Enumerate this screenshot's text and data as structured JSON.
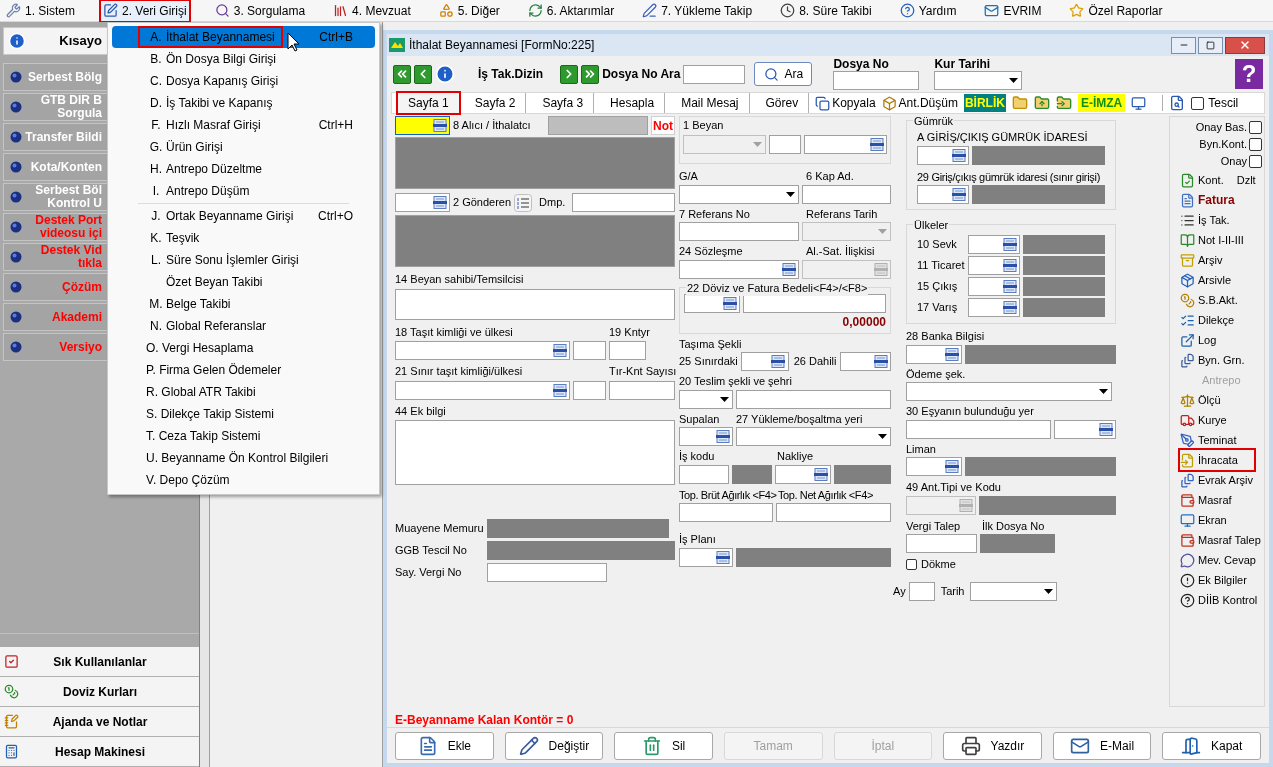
{
  "menubar": [
    {
      "label": "1. Sistem",
      "selected": false
    },
    {
      "label": "2. Veri Girişi",
      "selected": true
    },
    {
      "label": "3. Sorgulama",
      "selected": false
    },
    {
      "label": "4. Mevzuat",
      "selected": false
    },
    {
      "label": "5. Diğer",
      "selected": false
    },
    {
      "label": "6. Aktarımlar",
      "selected": false
    },
    {
      "label": "7. Yükleme Takip",
      "selected": false
    },
    {
      "label": "8. Süre Takibi",
      "selected": false
    },
    {
      "label": "Yardım",
      "selected": false
    },
    {
      "label": "EVRIM",
      "selected": false
    },
    {
      "label": "Özel Raporlar",
      "selected": false
    }
  ],
  "menu": {
    "groups": [
      [
        {
          "kind": "entry",
          "key": "A.",
          "label": "İthalat Beyannamesi",
          "shortcut": "Ctrl+B",
          "selected": true
        },
        {
          "kind": "entry",
          "key": "B.",
          "label": "Ön Dosya Bilgi Girişi",
          "selected": false
        },
        {
          "kind": "entry",
          "key": "C.",
          "label": "Dosya Kapanış Girişi",
          "selected": false
        },
        {
          "kind": "entry",
          "key": "D.",
          "label": "İş Takibi ve Kapanış",
          "selected": false
        },
        {
          "kind": "entry",
          "key": "F.",
          "label": "Hızlı Masraf Girişi",
          "shortcut": "Ctrl+H",
          "selected": false
        },
        {
          "kind": "entry",
          "key": "G.",
          "label": "Ürün Girişi",
          "selected": false
        },
        {
          "kind": "entry",
          "key": "H.",
          "label": "Antrepo Düzeltme",
          "selected": false
        },
        {
          "kind": "entry",
          "key": "I.",
          "label": "Antrepo Düşüm",
          "selected": false
        }
      ],
      [
        {
          "kind": "entry",
          "key": "J.",
          "label": "Ortak Beyanname Girişi",
          "shortcut": "Ctrl+O",
          "selected": false
        },
        {
          "kind": "entry",
          "key": "K.",
          "label": "Teşvik",
          "selected": false
        },
        {
          "kind": "entry",
          "key": "L.",
          "label": "Süre Sonu İşlemler Girişi",
          "selected": false
        },
        {
          "kind": "sub",
          "label": "Özet Beyan Takibi",
          "selected": false
        },
        {
          "kind": "entry",
          "key": "M.",
          "label": "Belge Takibi",
          "selected": false
        },
        {
          "kind": "entry",
          "key": "N.",
          "label": "Global Referanslar",
          "selected": false
        },
        {
          "kind": "plain",
          "label": "O. Vergi Hesaplama",
          "selected": false
        },
        {
          "kind": "plain",
          "label": "P. Firma Gelen Ödemeler",
          "selected": false
        },
        {
          "kind": "plain",
          "label": "R. Global ATR Takibi",
          "selected": false
        },
        {
          "kind": "plain",
          "label": "S. Dilekçe Takip Sistemi",
          "selected": false
        },
        {
          "kind": "plain",
          "label": "T. Ceza Takip Sistemi",
          "selected": false
        },
        {
          "kind": "plain",
          "label": "U. Beyanname Ön Kontrol Bilgileri",
          "selected": false
        },
        {
          "kind": "plain",
          "label": "V. Depo Çözüm",
          "selected": false
        }
      ]
    ]
  },
  "sidebar": {
    "header": "Kısayo",
    "items": [
      {
        "text": "Serbest Bölg",
        "kind": "normal"
      },
      {
        "text": "GTB DIR B\nSorgula",
        "kind": "normal"
      },
      {
        "text": "Transfer Bildi",
        "kind": "normal"
      },
      {
        "text": "Kota/Konten",
        "kind": "normal"
      },
      {
        "text": "Serbest Böl\nKontrol U",
        "kind": "normal"
      },
      {
        "text": "Destek Port\nvideosu içi",
        "kind": "support"
      },
      {
        "text": "Destek Vid\ntıkla",
        "kind": "support"
      },
      {
        "text": "Çözüm",
        "kind": "support"
      },
      {
        "text": "Akademi",
        "kind": "support"
      },
      {
        "text": "Versiyo",
        "kind": "support"
      }
    ],
    "bottom": [
      {
        "label": "Sık Kullanılanlar"
      },
      {
        "label": "Doviz Kurları"
      },
      {
        "label": "Ajanda ve Notlar"
      },
      {
        "label": "Hesap Makinesi"
      }
    ]
  },
  "window": {
    "title": "İthalat Beyannamesi [FormNo:225]"
  },
  "toolbar": {
    "dizin": "İş Tak.Dizin",
    "dosya_ara": "Dosya No Ara",
    "ara": "Ara",
    "dosya_no": "Dosya No",
    "kur_tarihi": "Kur Tarihi",
    "help": "?"
  },
  "tabs": [
    {
      "label": "Sayfa 1",
      "selected": true
    },
    {
      "label": "Sayfa 2",
      "selected": false
    },
    {
      "label": "Sayfa 3",
      "selected": false
    },
    {
      "label": "Hesapla",
      "selected": false
    },
    {
      "label": "Mail Mesaj",
      "selected": false
    },
    {
      "label": "Görev",
      "selected": false
    }
  ],
  "tab_tools": [
    {
      "label": "Kopyala"
    },
    {
      "label": "Ant.Düşüm"
    }
  ],
  "badges": [
    {
      "label": "BİRLİK",
      "color": "#008080"
    },
    {
      "label": "E-İMZA",
      "color": "#ffff00"
    }
  ],
  "tescil": {
    "label": "Tescil",
    "checked": false
  },
  "form": {
    "alici": "8 Alıcı / İthalatcı",
    "alici_focused": true,
    "not": "Not",
    "gonderen": "2 Gönderen",
    "dmp": "Dmp.",
    "beyan_sahibi": "14 Beyan sahibi/Temsilcisi",
    "tasit": "18 Taşıt kimliği ve ülkesi",
    "kntyr": "19 Kntyr",
    "sinir_tasit": "21 Sınır taşıt kimliği/ülkesi",
    "tir_knt": "Tır-Knt Sayısı",
    "ek_bilgi": "44 Ek bilgi",
    "muayene": "Muayene Memuru",
    "ggb": "GGB Tescil No",
    "say_vergi": "Say. Vergi No",
    "beyan": "1 Beyan",
    "ga": "G/A",
    "kap": "6 Kap Ad.",
    "referans_no": "7 Referans No",
    "referans_tarih": "Referans Tarih",
    "sozlesme": "24 Sözleşme",
    "al_sat": "Al.-Sat. İlişkisi",
    "doviz": "22 Döviz ve Fatura Bedeli<F4>/<F8>",
    "doviz_value": "0,00000",
    "tasima": "Taşıma Şekli",
    "sinirdaki": "25 Sınırdaki",
    "dahili": "26 Dahili",
    "teslim": "20 Teslim şekli ve şehri",
    "supalan": "Supalan",
    "yukleme": "27 Yükleme/boşaltma yeri",
    "is_kodu": "İş kodu",
    "nakliye": "Nakliye",
    "brut": "Top. Brüt Ağırlık <F4>",
    "net": "Top. Net Ağırlık <F4>",
    "is_plani": "İş Planı",
    "gumruk": "Gümrük",
    "giris_cikis": "A GİRİŞ/ÇIKIŞ GÜMRÜK İDARESİ",
    "sinir_giris": "29 Giriş/çıkış gümrük idaresi (sınır girişi)",
    "ulkeler": "Ülkeler",
    "ulke_rows": [
      "10 Sevk",
      "11 Ticaret",
      "15 Çıkış",
      "17 Varış"
    ],
    "banka": "28 Banka Bilgisi",
    "odeme": "Ödeme şek.",
    "esya_yer": "30 Eşyanın bulunduğu yer",
    "liman": "Liman",
    "ant_tipi": "49 Ant.Tipi ve Kodu",
    "vergi_talep": "Vergi Talep",
    "ilk_dosya": "İlk Dosya No",
    "dokme": {
      "label": "Dökme",
      "checked": false
    },
    "ay": "Ay",
    "tarih": "Tarih"
  },
  "approvals": [
    {
      "label": "Onay Bas.",
      "checked": false
    },
    {
      "label": "Byn.Kont.",
      "checked": false
    },
    {
      "label": "Onay",
      "checked": false
    }
  ],
  "tools": [
    {
      "label": "Kont.",
      "extra": "Dzlt",
      "kind": "normal",
      "disabled": false,
      "marked": false
    },
    {
      "label": "Fatura",
      "kind": "emphasis",
      "disabled": false,
      "marked": false
    },
    {
      "label": "İş Tak.",
      "kind": "normal",
      "disabled": false,
      "marked": false
    },
    {
      "label": "Not I-II-III",
      "kind": "normal",
      "disabled": false,
      "marked": false
    },
    {
      "label": "Arşiv",
      "kind": "normal",
      "disabled": false,
      "marked": false
    },
    {
      "label": "Arsivle",
      "kind": "normal",
      "disabled": false,
      "marked": false
    },
    {
      "label": "S.B.Akt.",
      "kind": "normal",
      "disabled": false,
      "marked": false
    },
    {
      "label": "Dilekçe",
      "kind": "normal",
      "disabled": false,
      "marked": false
    },
    {
      "label": "Log",
      "kind": "normal",
      "disabled": false,
      "marked": false
    },
    {
      "label": "Byn. Grn.",
      "kind": "normal",
      "disabled": false,
      "marked": false
    },
    {
      "label": "Antrepo",
      "kind": "normal",
      "disabled": true,
      "marked": false
    },
    {
      "label": "Ölçü",
      "kind": "normal",
      "disabled": false,
      "marked": false
    },
    {
      "label": "Kurye",
      "kind": "normal",
      "disabled": false,
      "marked": false
    },
    {
      "label": "Teminat",
      "kind": "normal",
      "disabled": false,
      "marked": false
    },
    {
      "label": "İhracata",
      "kind": "normal",
      "disabled": false,
      "marked": true
    },
    {
      "label": "Evrak Arşiv",
      "kind": "normal",
      "disabled": false,
      "marked": false
    },
    {
      "label": "Masraf",
      "kind": "normal",
      "disabled": false,
      "marked": false
    },
    {
      "label": "Ekran",
      "kind": "normal",
      "disabled": false,
      "marked": false
    },
    {
      "label": "Masraf Talep",
      "kind": "normal",
      "disabled": false,
      "marked": false
    },
    {
      "label": "Mev. Cevap",
      "kind": "normal",
      "disabled": false,
      "marked": false
    },
    {
      "label": "Ek Bilgiler",
      "kind": "normal",
      "disabled": false,
      "marked": false
    },
    {
      "label": "DİİB Kontrol",
      "kind": "normal",
      "disabled": false,
      "marked": false
    }
  ],
  "status": "E-Beyanname Kalan Kontör = 0",
  "buttons": [
    {
      "label": "Ekle",
      "disabled": false
    },
    {
      "label": "Değiştir",
      "disabled": false
    },
    {
      "label": "Sil",
      "disabled": false
    },
    {
      "label": "Tamam",
      "disabled": true
    },
    {
      "label": "İptal",
      "disabled": true
    },
    {
      "label": "Yazdır",
      "disabled": false
    },
    {
      "label": "E-Mail",
      "disabled": false
    },
    {
      "label": "Kapat",
      "disabled": false
    }
  ]
}
